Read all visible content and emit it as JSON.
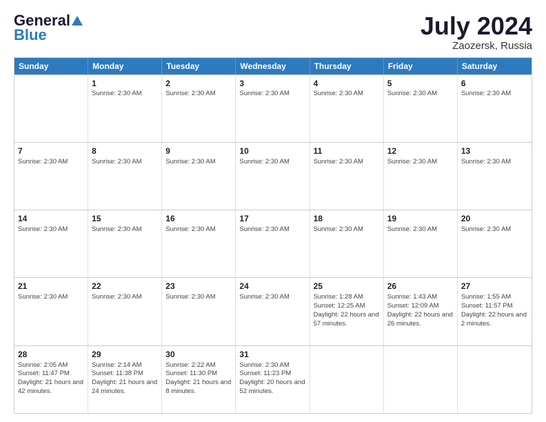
{
  "header": {
    "logo_line1": "General",
    "logo_line2": "Blue",
    "month_title": "July 2024",
    "location": "Zaozersk, Russia"
  },
  "weekdays": [
    "Sunday",
    "Monday",
    "Tuesday",
    "Wednesday",
    "Thursday",
    "Friday",
    "Saturday"
  ],
  "rows": [
    [
      {
        "day": "",
        "info": ""
      },
      {
        "day": "1",
        "info": "Sunrise: 2:30 AM"
      },
      {
        "day": "2",
        "info": "Sunrise: 2:30 AM"
      },
      {
        "day": "3",
        "info": "Sunrise: 2:30 AM"
      },
      {
        "day": "4",
        "info": "Sunrise: 2:30 AM"
      },
      {
        "day": "5",
        "info": "Sunrise: 2:30 AM"
      },
      {
        "day": "6",
        "info": "Sunrise: 2:30 AM"
      }
    ],
    [
      {
        "day": "7",
        "info": "Sunrise: 2:30 AM"
      },
      {
        "day": "8",
        "info": "Sunrise: 2:30 AM"
      },
      {
        "day": "9",
        "info": "Sunrise: 2:30 AM"
      },
      {
        "day": "10",
        "info": "Sunrise: 2:30 AM"
      },
      {
        "day": "11",
        "info": "Sunrise: 2:30 AM"
      },
      {
        "day": "12",
        "info": "Sunrise: 2:30 AM"
      },
      {
        "day": "13",
        "info": "Sunrise: 2:30 AM"
      }
    ],
    [
      {
        "day": "14",
        "info": "Sunrise: 2:30 AM"
      },
      {
        "day": "15",
        "info": "Sunrise: 2:30 AM"
      },
      {
        "day": "16",
        "info": "Sunrise: 2:30 AM"
      },
      {
        "day": "17",
        "info": "Sunrise: 2:30 AM"
      },
      {
        "day": "18",
        "info": "Sunrise: 2:30 AM"
      },
      {
        "day": "19",
        "info": "Sunrise: 2:30 AM"
      },
      {
        "day": "20",
        "info": "Sunrise: 2:30 AM"
      }
    ],
    [
      {
        "day": "21",
        "info": "Sunrise: 2:30 AM"
      },
      {
        "day": "22",
        "info": "Sunrise: 2:30 AM"
      },
      {
        "day": "23",
        "info": "Sunrise: 2:30 AM"
      },
      {
        "day": "24",
        "info": "Sunrise: 2:30 AM"
      },
      {
        "day": "25",
        "info": "Sunrise: 1:28 AM\nSunset: 12:25 AM\nDaylight: 22 hours and 57 minutes."
      },
      {
        "day": "26",
        "info": "Sunrise: 1:43 AM\nSunset: 12:09 AM\nDaylight: 22 hours and 26 minutes."
      },
      {
        "day": "27",
        "info": "Sunrise: 1:55 AM\nSunset: 11:57 PM\nDaylight: 22 hours and 2 minutes."
      }
    ],
    [
      {
        "day": "28",
        "info": "Sunrise: 2:05 AM\nSunset: 11:47 PM\nDaylight: 21 hours and 42 minutes."
      },
      {
        "day": "29",
        "info": "Sunrise: 2:14 AM\nSunset: 11:38 PM\nDaylight: 21 hours and 24 minutes."
      },
      {
        "day": "30",
        "info": "Sunrise: 2:22 AM\nSunset: 11:30 PM\nDaylight: 21 hours and 8 minutes."
      },
      {
        "day": "31",
        "info": "Sunrise: 2:30 AM\nSunset: 11:23 PM\nDaylight: 20 hours and 52 minutes."
      },
      {
        "day": "",
        "info": ""
      },
      {
        "day": "",
        "info": ""
      },
      {
        "day": "",
        "info": ""
      }
    ]
  ]
}
